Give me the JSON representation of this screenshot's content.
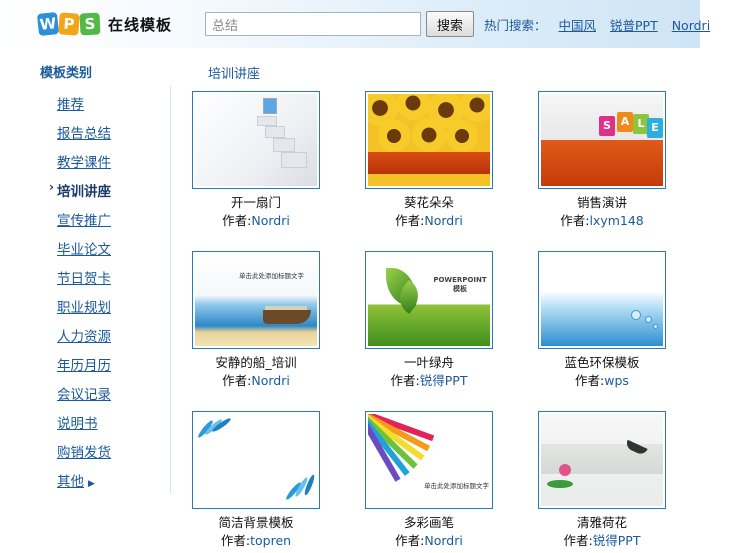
{
  "header": {
    "logo_letters": [
      "W",
      "P",
      "S"
    ],
    "logo_text": "在线模板",
    "search": {
      "value": "总结",
      "button_label": "搜索"
    },
    "hot_label": "热门搜索：",
    "hot_links": [
      "中国风",
      "锐普PPT",
      "Nordri"
    ]
  },
  "sidebar": {
    "title": "模板类别",
    "items": [
      {
        "label": "推荐",
        "active": false
      },
      {
        "label": "报告总结",
        "active": false
      },
      {
        "label": "教学课件",
        "active": false
      },
      {
        "label": "培训讲座",
        "active": true
      },
      {
        "label": "宣传推广",
        "active": false
      },
      {
        "label": "毕业论文",
        "active": false
      },
      {
        "label": "节日贺卡",
        "active": false
      },
      {
        "label": "职业规划",
        "active": false
      },
      {
        "label": "人力资源",
        "active": false
      },
      {
        "label": "年历月历",
        "active": false
      },
      {
        "label": "会议记录",
        "active": false
      },
      {
        "label": "说明书",
        "active": false
      },
      {
        "label": "购销发货",
        "active": false
      },
      {
        "label": "其他",
        "active": false,
        "has_arrow": true
      }
    ],
    "active_bullet": "›",
    "more_arrow": "▶"
  },
  "main": {
    "section_title": "培训讲座",
    "author_prefix": "作者:",
    "templates": [
      {
        "title": "开一扇门",
        "author": "Nordri",
        "thumb": "door"
      },
      {
        "title": "葵花朵朵",
        "author": "Nordri",
        "thumb": "sunflower"
      },
      {
        "title": "销售演讲",
        "author": "lxym148",
        "thumb": "sale"
      },
      {
        "title": "安静的船_培训",
        "author": "Nordri",
        "thumb": "boat"
      },
      {
        "title": "一叶绿舟",
        "author": "锐得PPT",
        "thumb": "leaf"
      },
      {
        "title": "蓝色环保模板",
        "author": "wps",
        "thumb": "wave"
      },
      {
        "title": "简洁背景模板",
        "author": "topren",
        "thumb": "blank"
      },
      {
        "title": "多彩画笔",
        "author": "Nordri",
        "thumb": "pencil"
      },
      {
        "title": "清雅荷花",
        "author": "锐得PPT",
        "thumb": "lotus"
      }
    ]
  },
  "thumb_texts": {
    "sale_letters": [
      "S",
      "A",
      "L",
      "E"
    ],
    "leaf_heading": "POWERPOINT模板",
    "boat_heading": "单击此处添加标题文字",
    "pencil_heading": "单击此处添加标题文字"
  },
  "colors": {
    "link": "#1a5a9c",
    "thumb_border": "#2a79b8",
    "header_gradient_end": "#cfe4f5"
  }
}
